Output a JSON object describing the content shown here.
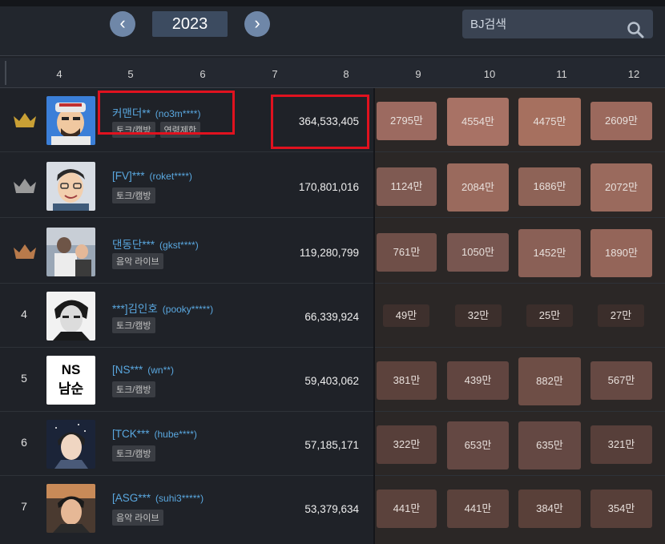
{
  "toolbar": {
    "prev_label": "‹",
    "year": "2023",
    "next_label": "›"
  },
  "search": {
    "placeholder": "BJ검색"
  },
  "header": {
    "columns": [
      "4",
      "5",
      "6",
      "7",
      "8",
      "9",
      "10",
      "11",
      "12"
    ]
  },
  "rows": [
    {
      "rank": "",
      "crown": "gold-crown-icon",
      "nick": "커맨더**",
      "uid": "(no3m****)",
      "tags": [
        "토크/캠방",
        "연령제한"
      ],
      "total": "364,533,405",
      "values": [
        "2795만",
        "4554만",
        "4475만",
        "2609만"
      ]
    },
    {
      "rank": "",
      "crown": "silver-crown-icon",
      "nick": "[FV]***",
      "uid": "(roket****)",
      "tags": [
        "토크/캠방"
      ],
      "total": "170,801,016",
      "values": [
        "1124만",
        "2084만",
        "1686만",
        "2072만"
      ]
    },
    {
      "rank": "",
      "crown": "bronze-crown-icon",
      "nick": "댄동단***",
      "uid": "(gkst****)",
      "tags": [
        "음악 라이브"
      ],
      "total": "119,280,799",
      "values": [
        "761만",
        "1050만",
        "1452만",
        "1890만"
      ]
    },
    {
      "rank": "4",
      "nick": "***]김인호",
      "uid": "(pooky*****)",
      "tags": [
        "토크/캠방"
      ],
      "total": "66,339,924",
      "values": [
        "49만",
        "32만",
        "25만",
        "27만"
      ]
    },
    {
      "rank": "5",
      "nick": "[NS***",
      "uid": "(wn**)",
      "tags": [
        "토크/캠방"
      ],
      "total": "59,403,062",
      "values": [
        "381만",
        "439만",
        "882만",
        "567만"
      ],
      "avatar_text": [
        "NS",
        "남순"
      ]
    },
    {
      "rank": "6",
      "nick": "[TCK***",
      "uid": "(hube****)",
      "tags": [
        "토크/캠방"
      ],
      "total": "57,185,171",
      "values": [
        "322만",
        "653만",
        "635만",
        "321만"
      ]
    },
    {
      "rank": "7",
      "nick": "[ASG***",
      "uid": "(suhi3*****)",
      "tags": [
        "음악 라이브"
      ],
      "total": "53,379,634",
      "values": [
        "441만",
        "441만",
        "384만",
        "354만"
      ]
    }
  ],
  "colors": {
    "accent_blue": "#5aa8e0",
    "highlight_red": "#e0121f",
    "gold": "#c9a035",
    "silver": "#9a9a9a",
    "bronze": "#b87a4b"
  }
}
